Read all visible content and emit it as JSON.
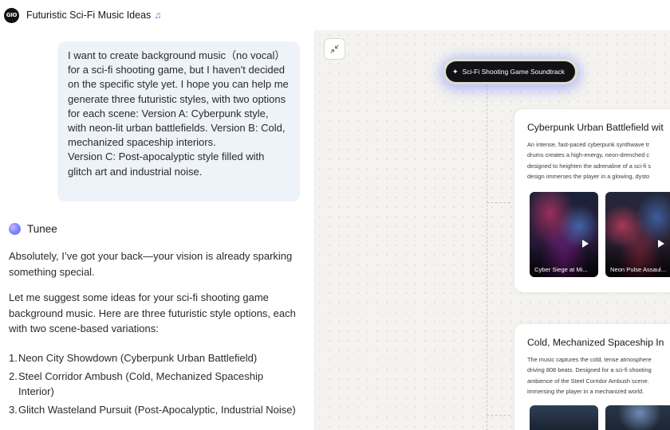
{
  "header": {
    "logo_text": "GIO",
    "title": "Futuristic Sci-Fi Music Ideas",
    "title_note": "♫"
  },
  "chat": {
    "user_message": "I want to create background music（no vocal） for a sci-fi shooting game, but I haven't decided on the specific style yet. I hope you can help me generate three futuristic styles, with two options for each scene: Version A: Cyberpunk style, with neon-lit urban battlefields. Version B: Cold, mechanized spaceship interiors.\nVersion C: Post-apocalyptic style filled with glitch art and industrial noise.",
    "assistant_name": "Tunee",
    "reply_1": "Absolutely, I’ve got your back—your vision is already sparking something special.",
    "reply_2": "Let me suggest some ideas for your sci-fi shooting game background music. Here are three futuristic style options, each with two scene-based variations:",
    "options": [
      {
        "num": "1.",
        "text": "Neon City Showdown (Cyberpunk Urban Battlefield)"
      },
      {
        "num": "2.",
        "text": "Steel Corridor Ambush (Cold, Mechanized Spaceship Interior)"
      },
      {
        "num": "3.",
        "text": "Glitch Wasteland Pursuit (Post-Apocalyptic, Industrial Noise)"
      }
    ]
  },
  "canvas": {
    "root_node": "Sci-Fi Shooting Game Soundtrack",
    "root_icon": "✦",
    "cards": [
      {
        "title": "Cyberpunk Urban Battlefield wit",
        "description": "An intense, fast-paced cyberpunk synthwave tr\ndrums creates a high-energy, neon-drenched c\ndesigned to heighten the adrenaline of a sci-fi s\ndesign immerses the player in a glowing, dysto",
        "tracks": [
          {
            "label": "Cyber Siege at Mi..."
          },
          {
            "label": "Neon Pulse Assaul..."
          }
        ]
      },
      {
        "title": "Cold, Mechanized Spaceship In",
        "description": "The music captures the cold, tense atmosphere\ndriving 808 beats. Designed for a sci-fi shooting\nambience of the Steel Corridor Ambush scene.\nimmersing the player in a mechanized world."
      }
    ]
  },
  "colors": {
    "canvas_bg": "#f4f3ef",
    "bubble_bg": "#eef2f9",
    "accent_purple": "#7b5ed8",
    "root_node_bg": "#121215"
  },
  "icons": {
    "collapse": "collapse-arrows-icon",
    "play": "play-icon",
    "sparkle": "sparkle-icon"
  }
}
